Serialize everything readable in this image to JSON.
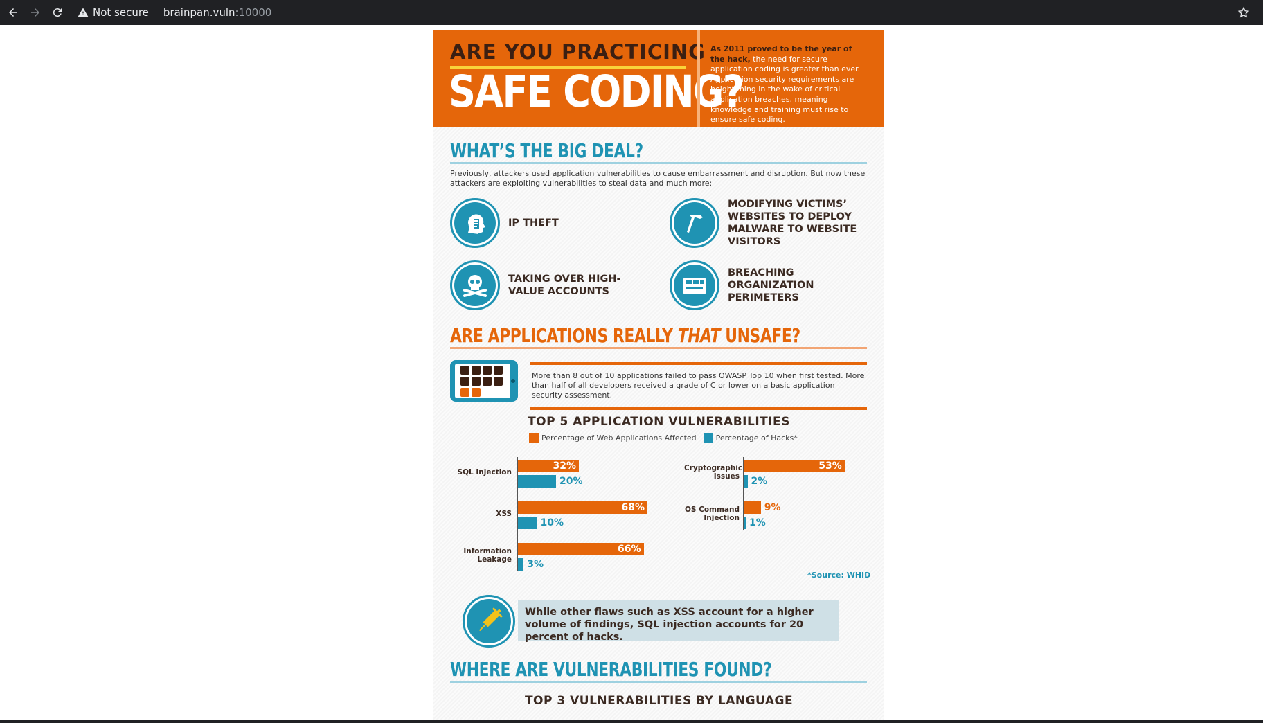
{
  "browser": {
    "security_label": "Not secure",
    "url_host": "brainpan.vuln",
    "url_port": ":10000"
  },
  "hero": {
    "title_line1": "ARE YOU PRACTICING",
    "title_line2": "SAFE CODING?",
    "desc_bold": "As 2011 proved to be the year of the hack,",
    "desc_rest": " the need for secure application coding is greater than ever. Application security requirements are heightening in the wake of critical application breaches, meaning knowledge and training must rise to ensure safe coding."
  },
  "big_deal": {
    "title": "WHAT’S THE BIG DEAL?",
    "intro": "Previously, attackers used application vulnerabilities to cause embarrassment and disruption. But now these attackers are exploiting vulnerabilities to steal data and much more:",
    "threats": [
      {
        "label": "IP THEFT",
        "icon": "head-hand-icon"
      },
      {
        "label": "MODIFYING VICTIMS’ WEBSITES TO DEPLOY MALWARE TO WEBSITE VISITORS",
        "icon": "hammer-icon"
      },
      {
        "label": "TAKING OVER HIGH-VALUE ACCOUNTS",
        "icon": "skull-crossbones-icon"
      },
      {
        "label": "BREACHING ORGANIZATION PERIMETERS",
        "icon": "wall-icon"
      }
    ]
  },
  "unsafe": {
    "title_pre": "ARE APPLICATIONS REALLY ",
    "title_em": "THAT",
    "title_post": " UNSAFE?",
    "stat": "More than 8 out of 10 applications failed to pass OWASP Top 10 when first tested. More than half of all developers received a grade of C or lower on a basic application security assessment."
  },
  "chart_data": {
    "type": "bar",
    "title": "TOP 5 APPLICATION VULNERABILITIES",
    "categories": [
      "SQL Injection",
      "XSS",
      "Information Leakage",
      "Cryptographic Issues",
      "OS Command Injection"
    ],
    "series": [
      {
        "name": "Percentage of Web Applications Affected",
        "color": "#e5660a",
        "values": [
          32,
          68,
          66,
          53,
          9
        ]
      },
      {
        "name": "Percentage of Hacks*",
        "color": "#1f93b3",
        "values": [
          20,
          10,
          3,
          2,
          1
        ]
      }
    ],
    "value_labels": {
      "affected": [
        "32%",
        "68%",
        "66%",
        "53%",
        "9%"
      ],
      "hacks": [
        "20%",
        "10%",
        "3%",
        "2%",
        "1%"
      ]
    },
    "source": "*Source: WHID"
  },
  "callout": {
    "text": "While other flaws such as XSS account for a higher volume of findings, SQL injection accounts for 20 percent of hacks.",
    "icon": "syringe-icon"
  },
  "found": {
    "title": "WHERE ARE VULNERABILITIES FOUND?",
    "chart2_title": "TOP 3 VULNERABILITIES BY LANGUAGE"
  },
  "colors": {
    "orange": "#e5660a",
    "teal": "#1f93b3",
    "dark_brown": "#3b1f12",
    "yellow": "#f9d33a"
  }
}
